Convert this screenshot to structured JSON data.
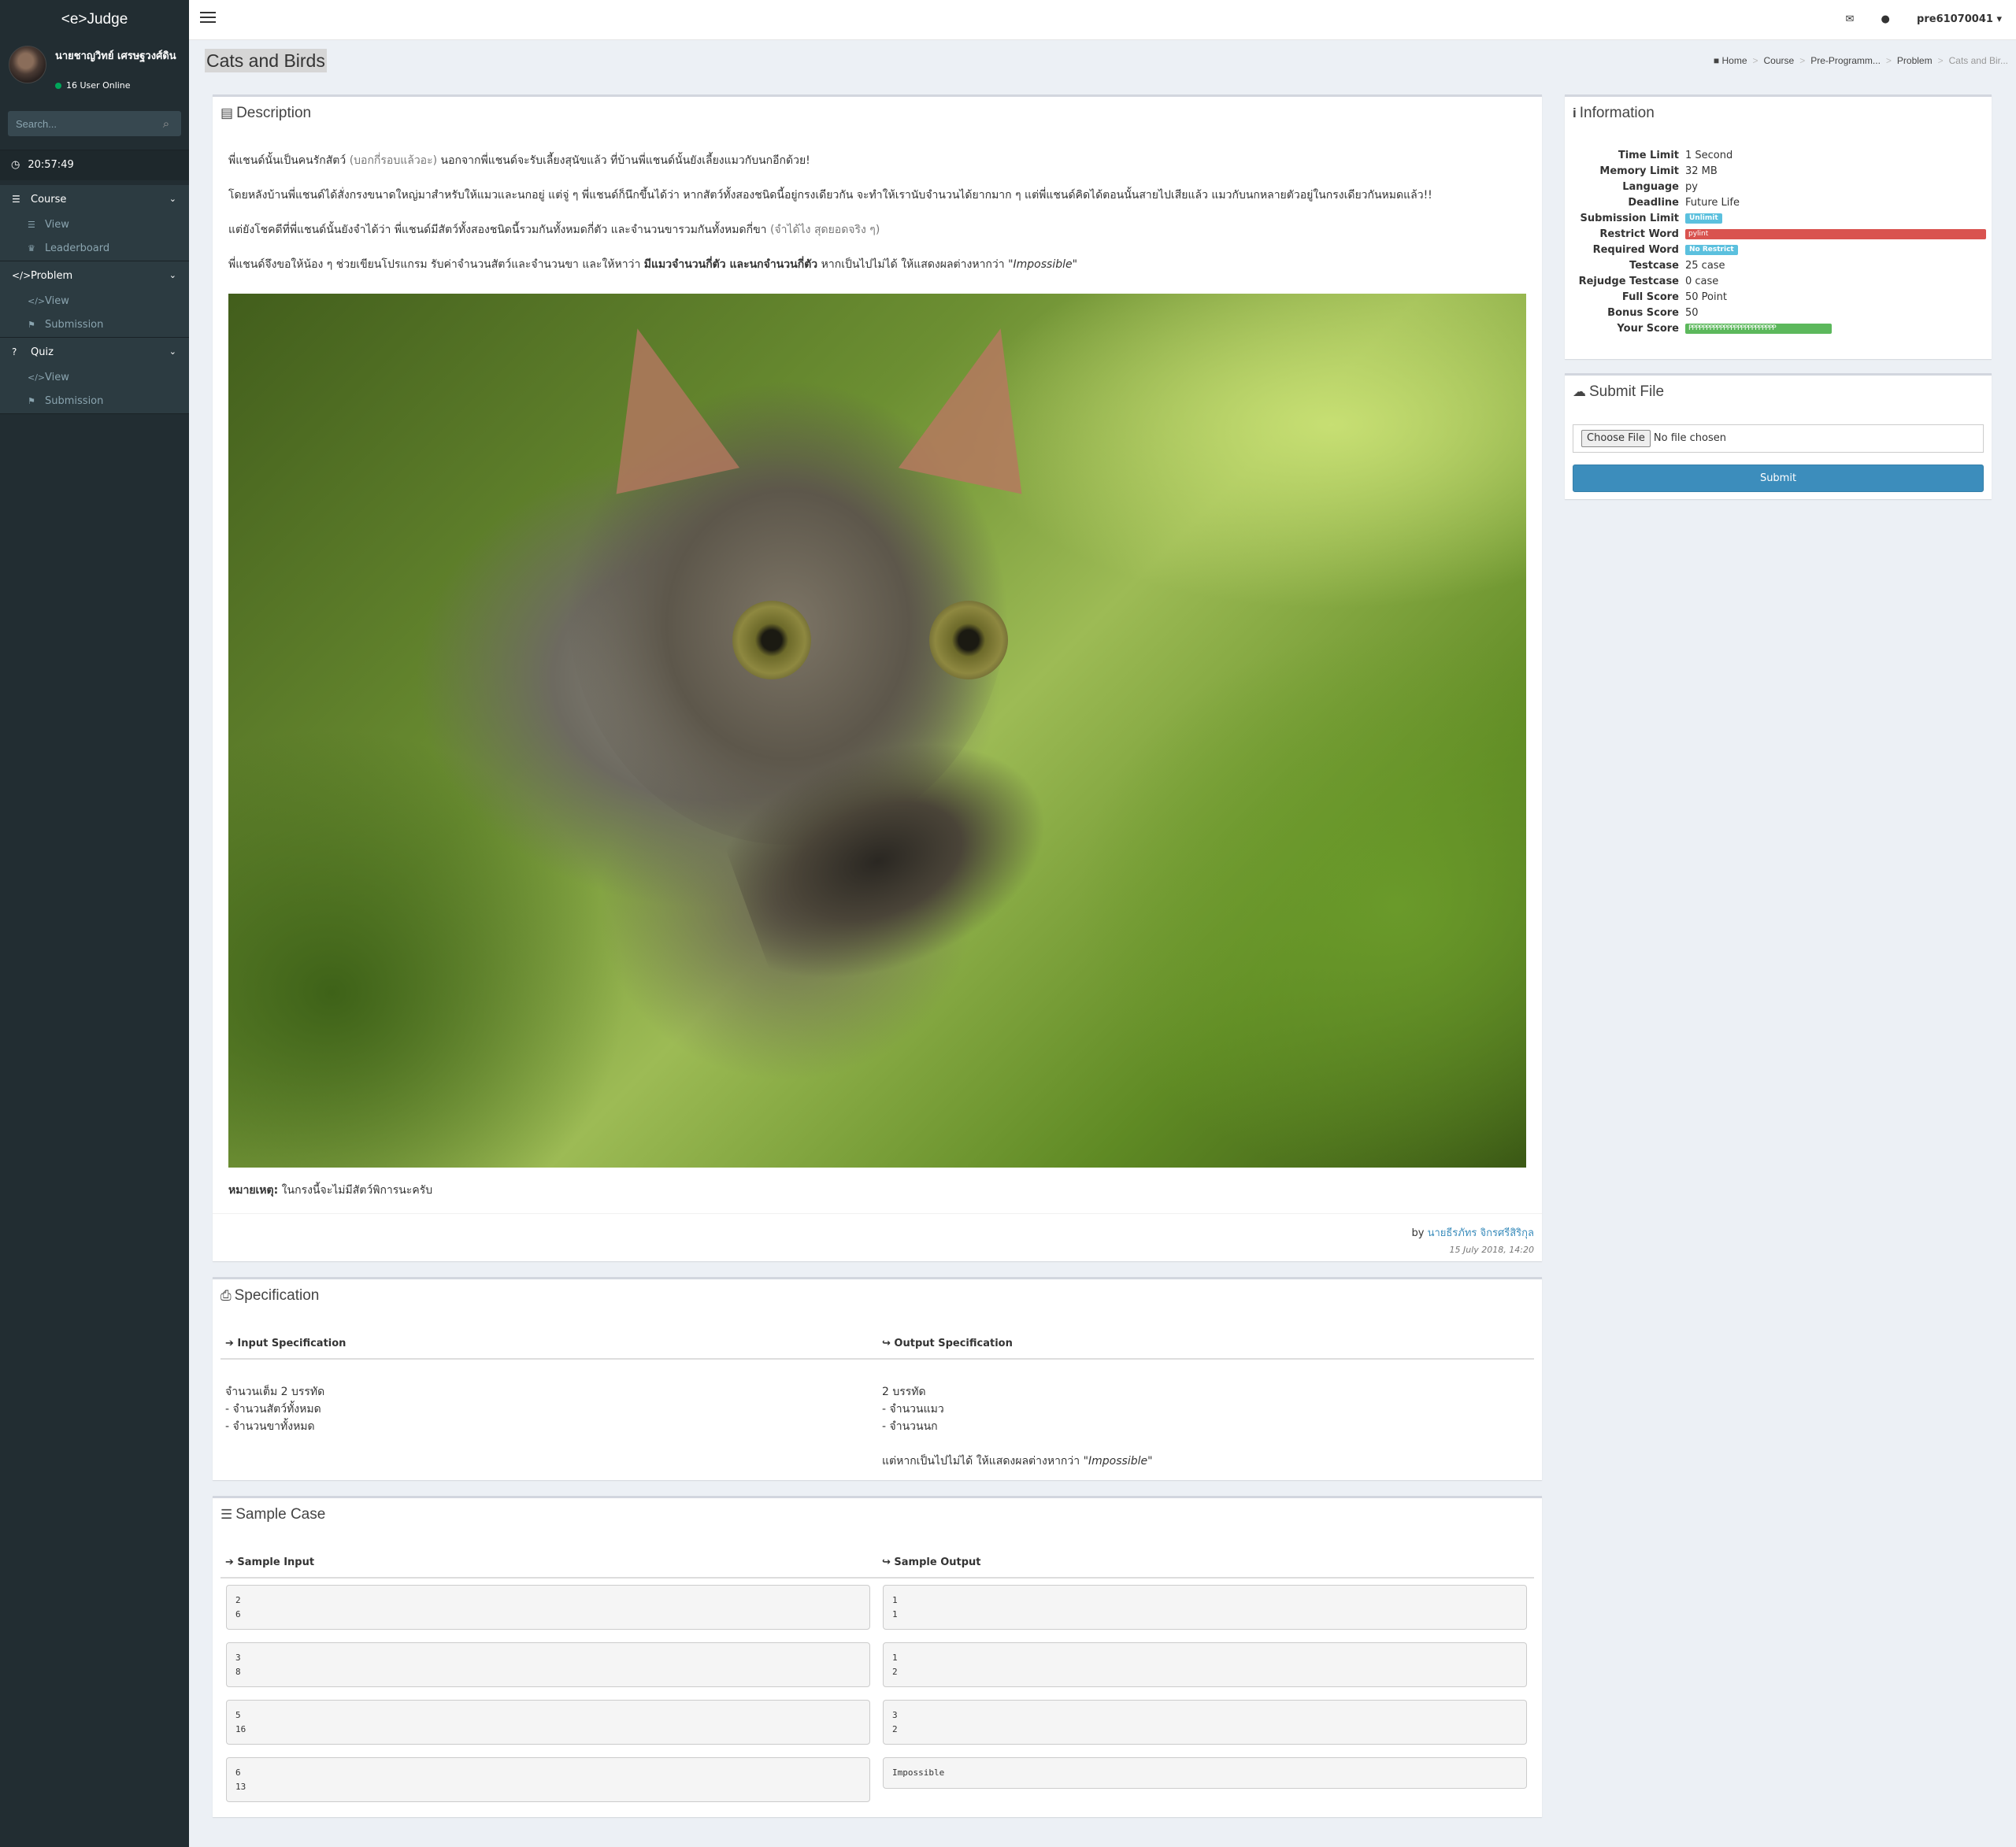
{
  "app": {
    "logo": "<e>Judge"
  },
  "user": {
    "name": "นายชาญวิทย์ เศรษฐวงศ์ดิน",
    "online": "16 User Online",
    "top_username": "pre61070041"
  },
  "search": {
    "placeholder": "Search..."
  },
  "clock": "20:57:49",
  "menu": {
    "course": {
      "label": "Course",
      "items": [
        "View",
        "Leaderboard"
      ]
    },
    "problem": {
      "label": "Problem",
      "items": [
        "View",
        "Submission"
      ]
    },
    "quiz": {
      "label": "Quiz",
      "items": [
        "View",
        "Submission"
      ]
    }
  },
  "page": {
    "title": "Cats and Birds",
    "breadcrumb": [
      "Home",
      "Course",
      "Pre-Programm...",
      "Problem",
      "Cats and Bir..."
    ]
  },
  "description": {
    "title": "Description",
    "p1_a": "พี่แชนด์นั้นเป็นคนรักสัตว์ ",
    "p1_b": "(บอกกี่รอบแล้วอะ)",
    "p1_c": " นอกจากพี่แชนด์จะรับเลี้ยงสุนัขแล้ว ที่บ้านพี่แชนด์นั้นยังเลี้ยงแมวกับนกอีกด้วย!",
    "p2": "โดยหลังบ้านพี่แชนด์ได้สั่งกรงขนาดใหญ่มาสำหรับให้แมวและนกอยู่ แต่จู่ ๆ พี่แชนด์ก็นึกขึ้นได้ว่า หากสัตว์ทั้งสองชนิดนี้อยู่กรงเดียวกัน จะทำให้เรานับจำนวนได้ยากมาก ๆ แต่พี่แชนด์คิดได้ตอนนั้นสายไปเสียแล้ว แมวกับนกหลายตัวอยู่ในกรงเดียวกันหมดแล้ว!!",
    "p3_a": "แต่ยังโชคดีที่พี่แชนด์นั้นยังจำได้ว่า พี่แชนด์มีสัตว์ทั้งสองชนิดนี้รวมกันทั้งหมดกี่ตัว และจำนวนขารวมกันทั้งหมดกี่ขา ",
    "p3_b": "(จำได้ไง สุดยอดจริง ๆ)",
    "p4_a": "พี่แชนด์จึงขอให้น้อง ๆ ช่วยเขียนโปรแกรม รับค่าจำนวนสัตว์และจำนวนขา และให้หาว่า ",
    "p4_b": "มีแมวจำนวนกี่ตัว และนกจำนวนกี่ตัว",
    "p4_c": " หากเป็นไปไม่ได้ ให้แสดงผลต่างหากว่า ",
    "p4_d": "\"Impossible\"",
    "note_label": "หมายเหตุ:",
    "note_text": " ในกรงนี้จะไม่มีสัตว์พิการนะครับ",
    "author_prefix": "by ",
    "author": "นายธีรภัทร จิกรศรีสิริกุล",
    "date": "15 July 2018, 14:20"
  },
  "specification": {
    "title": "Specification",
    "input_head": "Input Specification",
    "output_head": "Output Specification",
    "input_text": "จำนวนเต็ม 2 บรรทัด\n- จำนวนสัตว์ทั้งหมด\n- จำนวนขาทั้งหมด",
    "output_text": "2 บรรทัด\n- จำนวนแมว\n- จำนวนนก",
    "output_note_a": "แต่หากเป็นไปไม่ได้ ให้แสดงผลต่างหากว่า ",
    "output_note_b": "\"Impossible\""
  },
  "samples": {
    "title": "Sample Case",
    "input_head": "Sample Input",
    "output_head": "Sample Output",
    "cases": [
      {
        "input": "2\n6",
        "output": "1\n1"
      },
      {
        "input": "3\n8",
        "output": "1\n2"
      },
      {
        "input": "5\n16",
        "output": "3\n2"
      },
      {
        "input": "6\n13",
        "output": "Impossible"
      }
    ]
  },
  "information": {
    "title": "Information",
    "rows": {
      "time_limit": {
        "k": "Time Limit",
        "v": "1 Second"
      },
      "memory_limit": {
        "k": "Memory Limit",
        "v": "32 MB"
      },
      "language": {
        "k": "Language",
        "v": "py"
      },
      "deadline": {
        "k": "Deadline",
        "v": "Future Life"
      },
      "submission_limit": {
        "k": "Submission Limit",
        "v": "Unlimit"
      },
      "restrict_word": {
        "k": "Restrict Word",
        "v": "pylint"
      },
      "required_word": {
        "k": "Required Word",
        "v": "No Restrict"
      },
      "testcase": {
        "k": "Testcase",
        "v": "25 case"
      },
      "rejudge_testcase": {
        "k": "Rejudge Testcase",
        "v": "0 case"
      },
      "full_score": {
        "k": "Full Score",
        "v": "50 Point"
      },
      "bonus_score": {
        "k": "Bonus Score",
        "v": "50"
      },
      "your_score": {
        "k": "Your Score",
        "v": "PPPPPPPPPPPPPPPPPPPPPPPPP"
      }
    },
    "colors": {
      "info": "#5bc0de",
      "danger": "#d9534f",
      "success": "#5cb85c"
    }
  },
  "submit": {
    "title": "Submit File",
    "choose_label": "Choose File",
    "file_status": "No file chosen",
    "submit_label": "Submit"
  }
}
